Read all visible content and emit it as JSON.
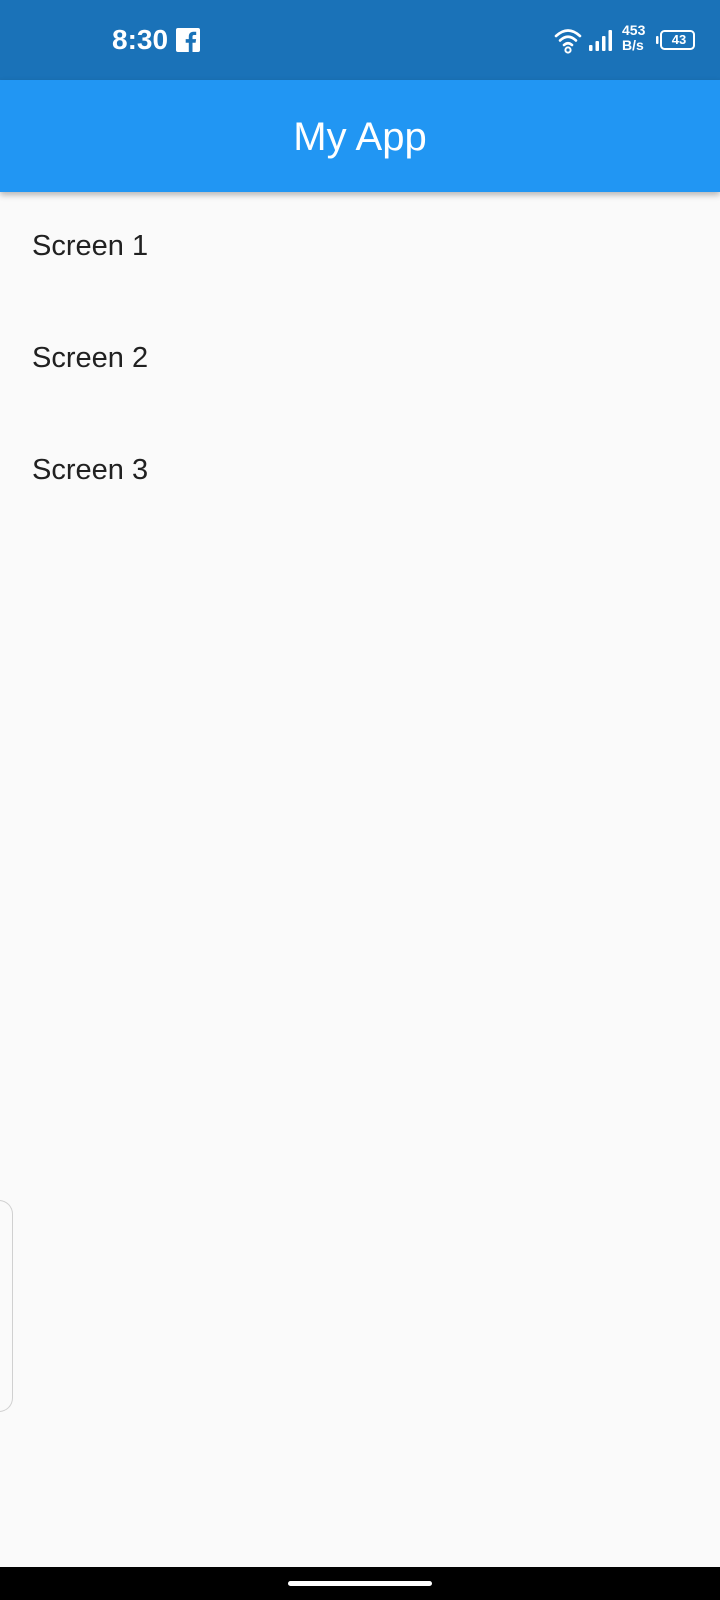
{
  "status_bar": {
    "time": "8:30",
    "notification_icon": "facebook-icon",
    "net_speed_value": "453",
    "net_speed_unit": "B/s",
    "battery_level": "43",
    "icons": [
      "wifi-icon",
      "signal-icon",
      "battery-icon"
    ]
  },
  "app_bar": {
    "title": "My App"
  },
  "list": {
    "items": [
      {
        "label": "Screen 1"
      },
      {
        "label": "Screen 2"
      },
      {
        "label": "Screen 3"
      }
    ]
  },
  "colors": {
    "status_bar": "#1a72b8",
    "app_bar": "#2196f3",
    "background": "#fafafa",
    "text": "#212121"
  }
}
